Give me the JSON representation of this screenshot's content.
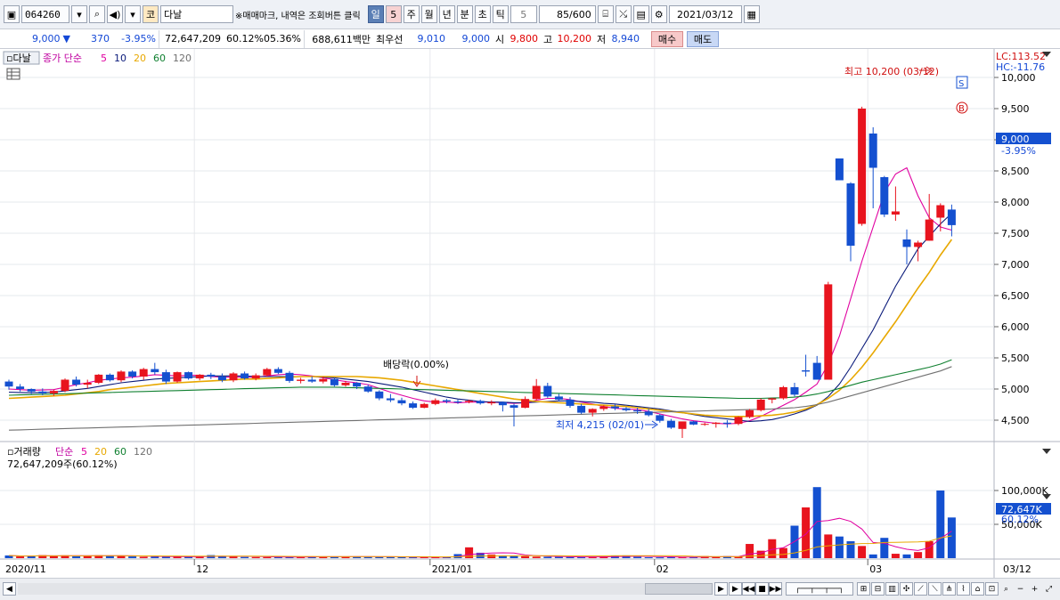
{
  "toolbar": {
    "code": "064260",
    "name": "다날",
    "market_badge": "코",
    "hint": "※매매마크, 내역은 조회버튼 클릭",
    "periods": [
      "일",
      "5",
      "주",
      "월",
      "년",
      "분",
      "초",
      "틱"
    ],
    "active_period": "일",
    "minute_value": "5",
    "count": "85/600",
    "date": "2021/03/12"
  },
  "quote": {
    "price": "9,000",
    "direction": "▼",
    "change": "370",
    "change_pct": "-3.95%",
    "volume": "72,647,209",
    "volume_pct": "60.12%",
    "turnover_pct": "05.36%",
    "amount": "688,611백만",
    "best_bid_label": "최우선",
    "best_bid": "9,010",
    "best_ask": "9,000",
    "open_label": "시",
    "open": "9,800",
    "high_label": "고",
    "high": "10,200",
    "low_label": "저",
    "low": "8,940",
    "buy_label": "매수",
    "sell_label": "매도"
  },
  "chart_data": {
    "type": "candlestick",
    "title_label": "다날",
    "ma_label": "종가 단순",
    "ma_periods": [
      "5",
      "10",
      "20",
      "60",
      "120"
    ],
    "ma_colors": [
      "#e000a0",
      "#0a1a7a",
      "#e8a800",
      "#108030",
      "#707070"
    ],
    "price_ylim": [
      4200,
      10400
    ],
    "price_ticks": [
      "10,000",
      "9,500",
      "9,000",
      "8,500",
      "8,000",
      "7,500",
      "7,000",
      "6,500",
      "6,000",
      "5,500",
      "5,000",
      "4,500"
    ],
    "price_tick_values": [
      10000,
      9500,
      9000,
      8500,
      8000,
      7500,
      7000,
      6500,
      6000,
      5500,
      5000,
      4500
    ],
    "lc": "LC:113.52",
    "hc": "HC:-11.76",
    "current_price": "9,000",
    "current_pct": "-3.95%",
    "high_note": "최고 10,200 (03/12)",
    "low_note": "최저 4,215 (02/01)",
    "dividend_note": "배당락(0.00%)",
    "sell_marker": "S",
    "buy_marker": "B",
    "up_color": "#e8141e",
    "down_color": "#1450d0",
    "candles_ohlc": [
      [
        5120,
        5150,
        4990,
        5040
      ],
      [
        5040,
        5080,
        4960,
        5000
      ],
      [
        5000,
        5010,
        4920,
        4960
      ],
      [
        4960,
        5010,
        4900,
        4930
      ],
      [
        4930,
        4990,
        4890,
        4970
      ],
      [
        4970,
        5170,
        4950,
        5150
      ],
      [
        5150,
        5200,
        5040,
        5070
      ],
      [
        5070,
        5150,
        5010,
        5100
      ],
      [
        5100,
        5240,
        5080,
        5230
      ],
      [
        5230,
        5250,
        5120,
        5140
      ],
      [
        5140,
        5300,
        5110,
        5280
      ],
      [
        5280,
        5300,
        5170,
        5200
      ],
      [
        5200,
        5340,
        5150,
        5320
      ],
      [
        5320,
        5420,
        5230,
        5270
      ],
      [
        5270,
        5310,
        5080,
        5120
      ],
      [
        5120,
        5280,
        5100,
        5270
      ],
      [
        5270,
        5280,
        5150,
        5170
      ],
      [
        5170,
        5240,
        5140,
        5230
      ],
      [
        5230,
        5260,
        5160,
        5200
      ],
      [
        5200,
        5250,
        5110,
        5140
      ],
      [
        5140,
        5270,
        5110,
        5250
      ],
      [
        5250,
        5280,
        5150,
        5170
      ],
      [
        5170,
        5250,
        5140,
        5220
      ],
      [
        5220,
        5340,
        5200,
        5320
      ],
      [
        5320,
        5350,
        5240,
        5260
      ],
      [
        5260,
        5290,
        5100,
        5130
      ],
      [
        5130,
        5180,
        5090,
        5150
      ],
      [
        5150,
        5200,
        5100,
        5120
      ],
      [
        5120,
        5200,
        5090,
        5160
      ],
      [
        5160,
        5180,
        5040,
        5060
      ],
      [
        5060,
        5130,
        5040,
        5100
      ],
      [
        5100,
        5110,
        5000,
        5040
      ],
      [
        5040,
        5070,
        4940,
        4960
      ],
      [
        4960,
        4980,
        4820,
        4850
      ],
      [
        4850,
        4920,
        4790,
        4820
      ],
      [
        4820,
        4860,
        4740,
        4770
      ],
      [
        4770,
        4800,
        4680,
        4700
      ],
      [
        4700,
        4780,
        4690,
        4760
      ],
      [
        4760,
        4850,
        4740,
        4820
      ],
      [
        4820,
        4840,
        4770,
        4800
      ],
      [
        4800,
        4830,
        4760,
        4790
      ],
      [
        4790,
        4830,
        4770,
        4810
      ],
      [
        4810,
        4830,
        4750,
        4770
      ],
      [
        4770,
        4820,
        4740,
        4790
      ],
      [
        4790,
        4800,
        4640,
        4740
      ],
      [
        4740,
        4760,
        4400,
        4700
      ],
      [
        4700,
        4880,
        4690,
        4840
      ],
      [
        4840,
        5160,
        4820,
        5050
      ],
      [
        5050,
        5100,
        4860,
        4880
      ],
      [
        4880,
        4920,
        4800,
        4830
      ],
      [
        4830,
        4870,
        4700,
        4730
      ],
      [
        4730,
        4760,
        4600,
        4620
      ],
      [
        4620,
        4690,
        4560,
        4680
      ],
      [
        4680,
        4740,
        4650,
        4720
      ],
      [
        4720,
        4750,
        4660,
        4690
      ],
      [
        4690,
        4710,
        4640,
        4660
      ],
      [
        4660,
        4700,
        4600,
        4640
      ],
      [
        4640,
        4680,
        4560,
        4580
      ],
      [
        4580,
        4600,
        4460,
        4490
      ],
      [
        4490,
        4520,
        4360,
        4380
      ],
      [
        4360,
        4470,
        4215,
        4480
      ],
      [
        4480,
        4490,
        4420,
        4430
      ],
      [
        4430,
        4460,
        4410,
        4440
      ],
      [
        4440,
        4470,
        4380,
        4460
      ],
      [
        4460,
        4500,
        4380,
        4440
      ],
      [
        4440,
        4560,
        4420,
        4550
      ],
      [
        4550,
        4680,
        4530,
        4660
      ],
      [
        4660,
        4850,
        4640,
        4830
      ],
      [
        4830,
        4860,
        4770,
        4850
      ],
      [
        4850,
        5050,
        4830,
        5030
      ],
      [
        5030,
        5100,
        4880,
        4910
      ],
      [
        5300,
        5550,
        5200,
        5280
      ],
      [
        5420,
        5530,
        5150,
        5150
      ],
      [
        5150,
        6720,
        5150,
        6680
      ],
      [
        8700,
        8700,
        8350,
        8350
      ],
      [
        8300,
        8320,
        7050,
        7300
      ],
      [
        7650,
        9530,
        7620,
        9500
      ],
      [
        9100,
        9200,
        7900,
        8550
      ],
      [
        8400,
        8420,
        7760,
        7800
      ],
      [
        7800,
        8250,
        7700,
        7850
      ],
      [
        7400,
        7560,
        7000,
        7280
      ],
      [
        7280,
        7380,
        7050,
        7350
      ],
      [
        7380,
        8130,
        7380,
        7720
      ],
      [
        7750,
        7980,
        7530,
        7950
      ],
      [
        7880,
        7960,
        7450,
        7630
      ]
    ],
    "ma_series": {
      "5": [
        5000,
        4990,
        4980,
        4985,
        4990,
        5030,
        5070,
        5100,
        5140,
        5160,
        5180,
        5190,
        5210,
        5230,
        5220,
        5210,
        5220,
        5220,
        5200,
        5190,
        5190,
        5190,
        5190,
        5210,
        5230,
        5240,
        5230,
        5210,
        5180,
        5150,
        5120,
        5100,
        5070,
        5010,
        4950,
        4900,
        4850,
        4810,
        4790,
        4790,
        4780,
        4790,
        4790,
        4790,
        4780,
        4770,
        4780,
        4820,
        4850,
        4850,
        4830,
        4790,
        4760,
        4720,
        4690,
        4680,
        4670,
        4640,
        4600,
        4560,
        4520,
        4490,
        4470,
        4450,
        4440,
        4450,
        4490,
        4560,
        4650,
        4740,
        4830,
        4950,
        5080,
        5400,
        5850,
        6450,
        7050,
        7600,
        8150,
        8450,
        8550,
        8100,
        7750,
        7600,
        7550
      ],
      "10": [
        4950,
        4945,
        4940,
        4945,
        4950,
        4970,
        4990,
        5010,
        5040,
        5070,
        5100,
        5120,
        5140,
        5160,
        5170,
        5180,
        5190,
        5200,
        5210,
        5210,
        5210,
        5210,
        5200,
        5200,
        5200,
        5200,
        5200,
        5200,
        5190,
        5180,
        5160,
        5140,
        5120,
        5090,
        5060,
        5030,
        4990,
        4950,
        4910,
        4870,
        4840,
        4820,
        4800,
        4790,
        4790,
        4780,
        4780,
        4790,
        4800,
        4810,
        4810,
        4800,
        4790,
        4770,
        4760,
        4740,
        4720,
        4700,
        4680,
        4650,
        4620,
        4590,
        4560,
        4540,
        4520,
        4500,
        4480,
        4490,
        4510,
        4550,
        4600,
        4660,
        4740,
        4880,
        5080,
        5350,
        5650,
        5950,
        6300,
        6650,
        6950,
        7250,
        7450,
        7650,
        7820
      ],
      "20": [
        4850,
        4860,
        4870,
        4880,
        4890,
        4900,
        4920,
        4940,
        4960,
        4990,
        5010,
        5030,
        5050,
        5070,
        5090,
        5100,
        5110,
        5120,
        5130,
        5140,
        5150,
        5160,
        5160,
        5170,
        5180,
        5190,
        5200,
        5200,
        5200,
        5200,
        5200,
        5200,
        5190,
        5180,
        5160,
        5140,
        5110,
        5080,
        5050,
        5020,
        4990,
        4960,
        4930,
        4900,
        4870,
        4840,
        4820,
        4800,
        4790,
        4780,
        4770,
        4760,
        4750,
        4740,
        4730,
        4720,
        4700,
        4680,
        4660,
        4640,
        4620,
        4600,
        4580,
        4570,
        4560,
        4560,
        4560,
        4570,
        4580,
        4600,
        4630,
        4680,
        4750,
        4850,
        4980,
        5150,
        5350,
        5580,
        5830,
        6080,
        6350,
        6620,
        6870,
        7150,
        7400
      ],
      "60": [
        4900,
        4905,
        4910,
        4915,
        4920,
        4925,
        4930,
        4935,
        4940,
        4945,
        4950,
        4955,
        4960,
        4965,
        4970,
        4975,
        4980,
        4985,
        4990,
        4995,
        5000,
        5005,
        5010,
        5015,
        5020,
        5025,
        5030,
        5030,
        5030,
        5030,
        5025,
        5020,
        5015,
        5010,
        5005,
        5000,
        4995,
        4990,
        4985,
        4980,
        4975,
        4970,
        4965,
        4960,
        4955,
        4950,
        4945,
        4940,
        4935,
        4930,
        4925,
        4920,
        4915,
        4910,
        4905,
        4900,
        4895,
        4890,
        4885,
        4880,
        4875,
        4870,
        4865,
        4860,
        4855,
        4850,
        4850,
        4850,
        4855,
        4860,
        4870,
        4890,
        4920,
        4960,
        5010,
        5060,
        5110,
        5150,
        5190,
        5230,
        5270,
        5310,
        5350,
        5400,
        5470
      ],
      "120": [
        4340,
        4345,
        4350,
        4355,
        4360,
        4365,
        4370,
        4375,
        4380,
        4385,
        4390,
        4395,
        4400,
        4405,
        4410,
        4415,
        4420,
        4425,
        4430,
        4435,
        4440,
        4445,
        4450,
        4455,
        4460,
        4465,
        4470,
        4475,
        4480,
        4485,
        4490,
        4495,
        4500,
        4505,
        4510,
        4515,
        4520,
        4525,
        4530,
        4535,
        4540,
        4545,
        4550,
        4555,
        4560,
        4565,
        4570,
        4575,
        4580,
        4585,
        4590,
        4595,
        4600,
        4605,
        4610,
        4615,
        4620,
        4625,
        4630,
        4635,
        4640,
        4645,
        4650,
        4655,
        4660,
        4665,
        4670,
        4675,
        4680,
        4690,
        4700,
        4720,
        4750,
        4790,
        4840,
        4890,
        4940,
        4990,
        5040,
        5090,
        5140,
        5190,
        5240,
        5290,
        5360
      ]
    },
    "volume_label": "거래량",
    "volume_ma_label": "단순",
    "volume_ma_periods": [
      "5",
      "20",
      "60",
      "120"
    ],
    "volume_caption": "72,647,209주(60.12%)",
    "volume_ylim": [
      0,
      150000
    ],
    "volume_ticks": [
      "100,000K",
      "50,000K"
    ],
    "volume_tick_values": [
      100000,
      50000
    ],
    "volume_current": "72,647K",
    "volume_current_pct": "60.12%",
    "volumes_k": [
      3000,
      2000,
      2500,
      2000,
      2200,
      4000,
      2500,
      3000,
      4500,
      3200,
      4200,
      2600,
      3500,
      4300,
      3500,
      3600,
      2500,
      2000,
      2200,
      1900,
      2500,
      2000,
      2200,
      4500,
      3000,
      2400,
      1700,
      1600,
      1600,
      2200,
      1600,
      1700,
      2100,
      2600,
      2200,
      2000,
      2600,
      1800,
      2200,
      1800,
      1500,
      1300,
      1500,
      1300,
      1900,
      6000,
      16000,
      8000,
      5400,
      4000,
      3800,
      2800,
      2200,
      2000,
      1800,
      1700,
      1600,
      1900,
      2500,
      3200,
      4100,
      1900,
      1300,
      1200,
      1300,
      1700,
      2000,
      3200,
      1500,
      3000,
      2200,
      21000,
      11000,
      28000,
      15000,
      48000,
      75000,
      105000,
      35000,
      32000,
      25000,
      18000,
      5500,
      30000,
      6500,
      5500,
      9000,
      25000,
      100000,
      60120
    ],
    "volume_up": [
      false,
      true,
      false,
      true,
      true,
      true,
      false,
      true,
      true,
      false,
      true,
      false,
      true,
      false,
      false,
      true,
      false,
      true,
      false,
      false,
      true,
      false,
      true,
      true,
      false,
      false,
      true,
      false,
      true,
      false,
      true,
      false,
      false,
      false,
      false,
      false,
      false,
      true,
      true,
      false,
      false,
      true,
      false,
      true,
      false,
      false,
      true,
      true,
      false,
      false,
      false,
      false,
      true,
      true,
      false,
      false,
      false,
      false,
      false,
      false,
      true,
      false,
      true,
      true,
      false,
      true,
      true,
      true,
      true,
      true,
      false,
      true,
      false,
      true,
      false,
      false,
      true,
      false,
      false,
      true,
      false,
      true,
      true,
      false,
      false
    ],
    "x_labels": [
      "2020/11",
      "12",
      "2021/01",
      "02",
      "03",
      "03/12"
    ],
    "x_label_index": [
      0,
      17,
      38,
      58,
      77,
      0
    ]
  },
  "scrollbar": {
    "left_arrow": "◀",
    "right_arrow": "▶",
    "play_buttons": [
      "▶",
      "◀◀",
      "■",
      "▶▶"
    ]
  }
}
